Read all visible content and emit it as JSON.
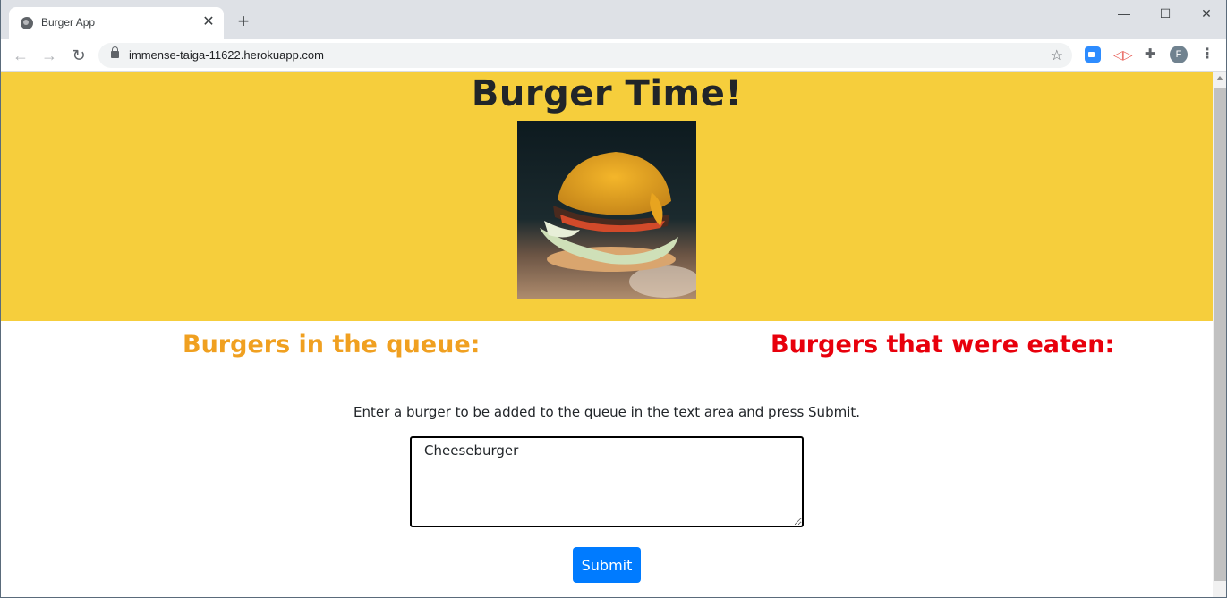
{
  "browser": {
    "tab_title": "Burger App",
    "tab_close": "✕",
    "new_tab": "+",
    "url": "immense-taiga-11622.herokuapp.com",
    "window_controls": {
      "minimize": "—",
      "maximize": "☐",
      "close": "✕"
    },
    "profile_initial": "F",
    "icons": [
      "globe-icon",
      "back-icon",
      "forward-icon",
      "reload-icon",
      "lock-icon",
      "star-icon",
      "zoom-icon",
      "screencast-icon",
      "extensions-icon",
      "profile-avatar",
      "menu-icon"
    ]
  },
  "page": {
    "title": "Burger Time!",
    "queue_heading": "Burgers in the queue:",
    "eaten_heading": "Burgers that were eaten:",
    "instructions": "Enter a burger to be added to the queue in the text area and press Submit.",
    "textarea_value": "Cheeseburger",
    "submit_label": "Submit"
  },
  "colors": {
    "hero_bg": "#f6ce3c",
    "queue_heading": "#f0a020",
    "eaten_heading": "#e8000c",
    "submit_bg": "#007bff"
  }
}
